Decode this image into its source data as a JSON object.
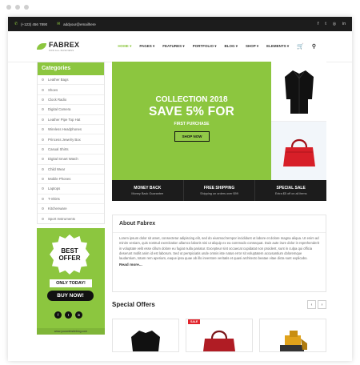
{
  "topbar": {
    "phone": "(+123) 456 7890",
    "email": "addyour@emailhere",
    "social": [
      "f",
      "t",
      "ig",
      "in"
    ]
  },
  "logo": {
    "name": "FABREX",
    "tagline": "FOR ALL BUSINESS"
  },
  "nav": {
    "items": [
      "HOME ▾",
      "PAGES ▾",
      "FEATURES ▾",
      "PORTFOLIO ▾",
      "BLOG ▾",
      "SHOP ▾",
      "ELEMENTS ▾"
    ]
  },
  "categories": {
    "title": "Categories",
    "items": [
      "Leather Bags",
      "Shoes",
      "Clock Radio",
      "Digital Camera",
      "Leather Pipe Top Hat",
      "Wireless Headphones",
      "Princess Jewelry Box",
      "Casual Shirts",
      "Digital Smart Watch",
      "Child Wear",
      "Mobile Phones",
      "Laptops",
      "T-Shirts",
      "Kitchenware",
      "Sport Instruments"
    ]
  },
  "promo": {
    "badge_line1": "BEST",
    "badge_line2": "OFFER",
    "only_today": "ONLY TODAY!",
    "buy_now": "BUY NOW!",
    "social": [
      "f",
      "t",
      "in"
    ],
    "url": "www.yourwebsiteblog.com"
  },
  "hero": {
    "collection": "COLLECTION 2018",
    "headline": "SAVE 5% FOR",
    "subline": "FIRST PURCHASE",
    "cta": "SHOP NOW"
  },
  "services": [
    {
      "title": "MONEY BACK",
      "subtitle": "Money Back Guarantee"
    },
    {
      "title": "FREE SHIPPING",
      "subtitle": "Shipping on orders over $99"
    },
    {
      "title": "SPECIAL SALE",
      "subtitle": "Extra $5 off on all items"
    }
  ],
  "about": {
    "title": "About Fabrex",
    "text": "Lorem ipsum dolor sit amet, consectetur adipiscing elit, sed do eiusmod tempor incididunt ut labore et dolore magna aliqua. Ut enim ad minim veniam, quis nostrud exercitation ullamco laboris nisi ut aliquip ex ea commodo consequat. Duis aute irure dolor in reprehenderit in voluptate velit esse cillum dolore eu fugiat nulla pariatur. Excepteur sint occaecat cupidatat non proident, sunt in culpa qui officia deserunt mollit anim id est laborum. Sed ut perspiciatis unde omnis iste natus error sit voluptatem accusantium doloremque laudantium, totam rem aperiam, eaque ipsa quae ab illo inventore veritatis et quasi architecto beatae vitae dicta sunt explicabo.",
    "more": "Read more..."
  },
  "offers": {
    "title": "Special Offers",
    "prev": "‹",
    "next": "›",
    "sale_label": "SALE"
  },
  "colors": {
    "accent": "#8cc63f",
    "dark": "#1c1c1c",
    "sale": "#e1232b"
  }
}
